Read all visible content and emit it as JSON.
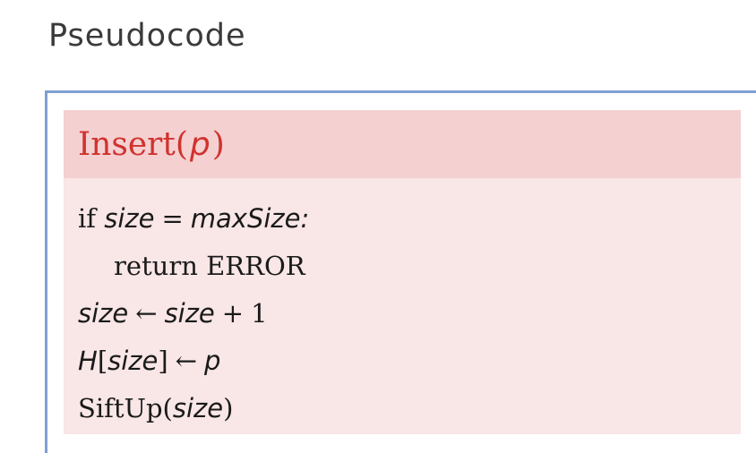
{
  "heading": "Pseudocode",
  "algorithm": {
    "name": "Insert",
    "param": "p",
    "lines": {
      "l1_keyword": "if",
      "l1_var": "size",
      "l1_op": "=",
      "l1_rhs": "maxSize",
      "l1_colon": ":",
      "l2_keyword": "return",
      "l2_value": "ERROR",
      "l3_lhs": "size",
      "l3_arrow": "←",
      "l3_rhs": "size",
      "l3_op": "+",
      "l3_num": "1",
      "l4_array": "H",
      "l4_index": "size",
      "l4_arrow": "←",
      "l4_rhs": "p",
      "l5_func": "SiftUp",
      "l5_arg": "size"
    }
  },
  "colors": {
    "header_text": "#d1322e",
    "header_bg": "#f4d0d1",
    "body_bg": "#f9e6e6",
    "frame": "#7f9fd0"
  }
}
